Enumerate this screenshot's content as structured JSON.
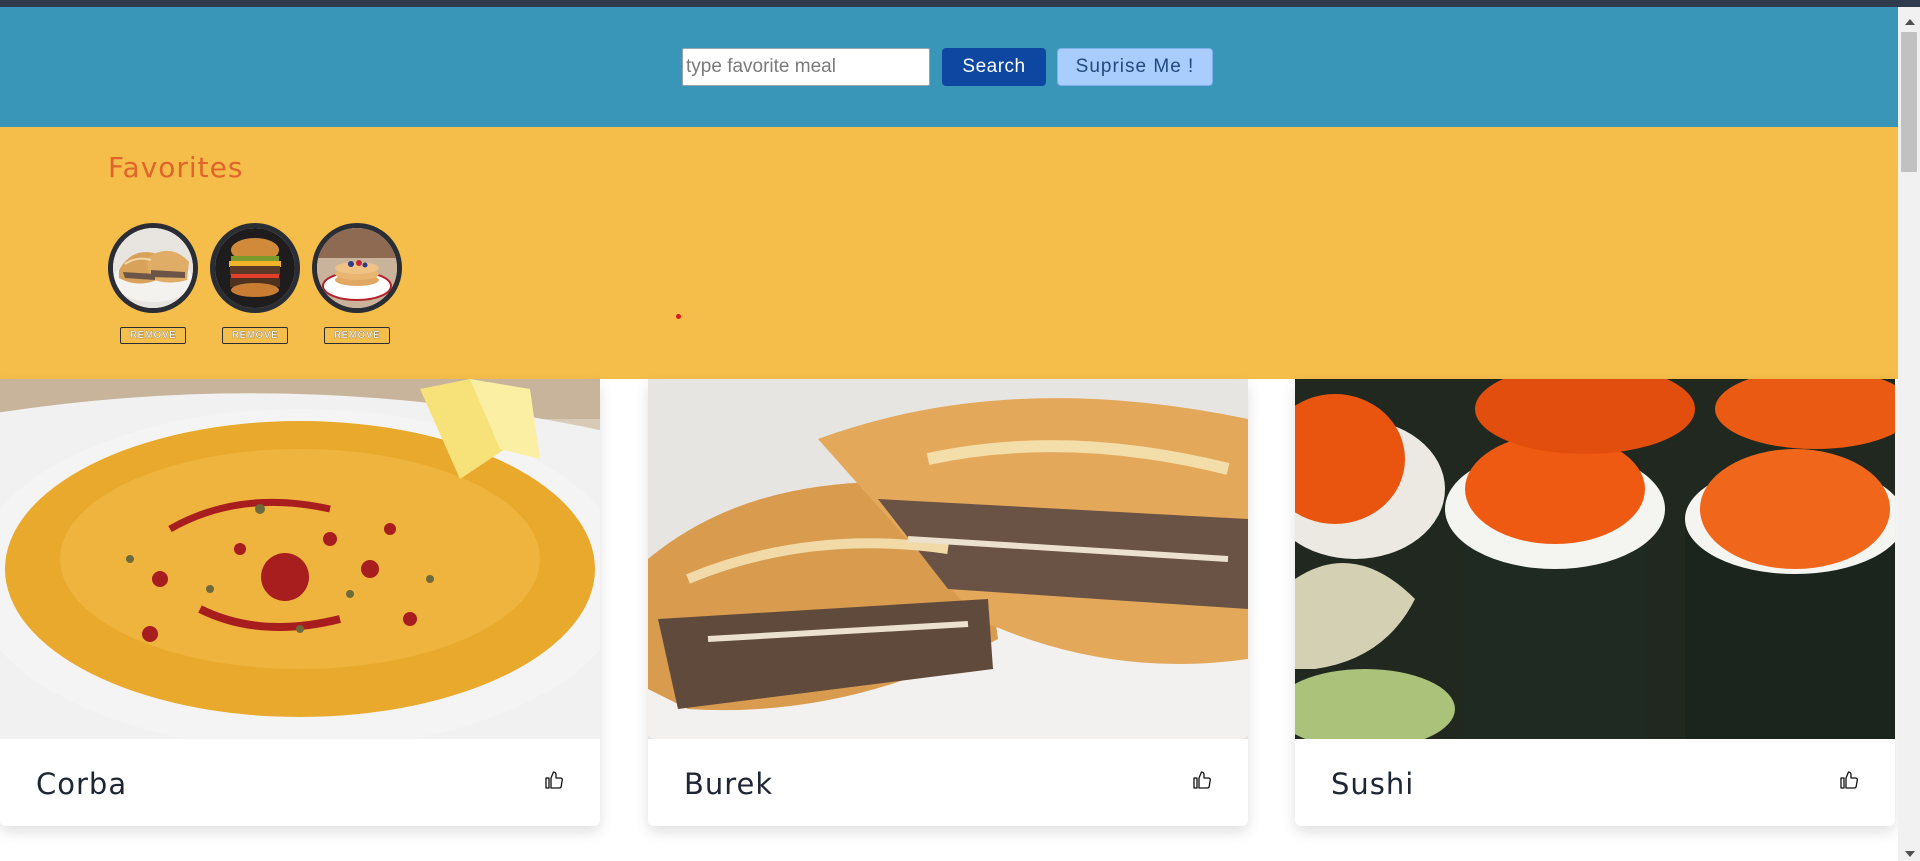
{
  "header": {
    "search_placeholder": "type favorite meal",
    "search_value": "",
    "search_button_label": "Search",
    "surprise_button_label": "Suprise Me !"
  },
  "favorites": {
    "title": "Favorites",
    "items": [
      {
        "name": "Burek",
        "remove_label": "REMOVE"
      },
      {
        "name": "Burger",
        "remove_label": "REMOVE"
      },
      {
        "name": "Pancakes",
        "remove_label": "REMOVE"
      }
    ]
  },
  "meals": [
    {
      "title": "Corba",
      "like_icon": "thumbs-up-icon"
    },
    {
      "title": "Burek",
      "like_icon": "thumbs-up-icon"
    },
    {
      "title": "Sushi",
      "like_icon": "thumbs-up-icon"
    }
  ],
  "colors": {
    "header_bg": "#3a96b8",
    "favorites_bg": "#f5be4a",
    "favorites_title": "#e2642a",
    "search_button_bg": "#0d47a1",
    "surprise_button_bg": "#a9cdfc"
  }
}
